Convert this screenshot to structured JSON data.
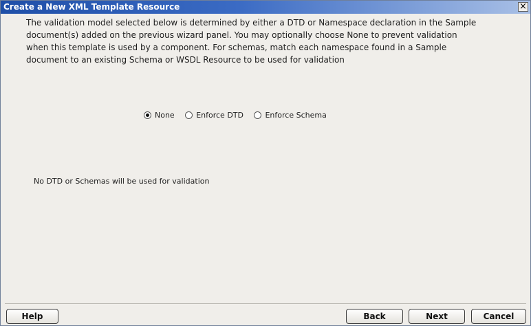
{
  "window": {
    "title": "Create a New XML Template Resource",
    "close_glyph": "×",
    "close_icon": "close-icon"
  },
  "description": {
    "line1": "The validation model selected below is determined by either a DTD or Namespace declaration in the Sample",
    "line2": "document(s) added on the previous wizard panel.  You may optionally choose None to prevent validation",
    "line3": "when this template is used by a component.  For schemas, match each namespace found in a Sample",
    "line4": "document to an existing Schema or WSDL Resource to be used for validation"
  },
  "validation": {
    "options": [
      {
        "label": "None",
        "selected": true
      },
      {
        "label": "Enforce DTD",
        "selected": false
      },
      {
        "label": "Enforce Schema",
        "selected": false
      }
    ],
    "status_text": "No DTD or Schemas will be used for validation"
  },
  "buttons": {
    "help": "Help",
    "back": "Back",
    "next": "Next",
    "cancel": "Cancel"
  }
}
